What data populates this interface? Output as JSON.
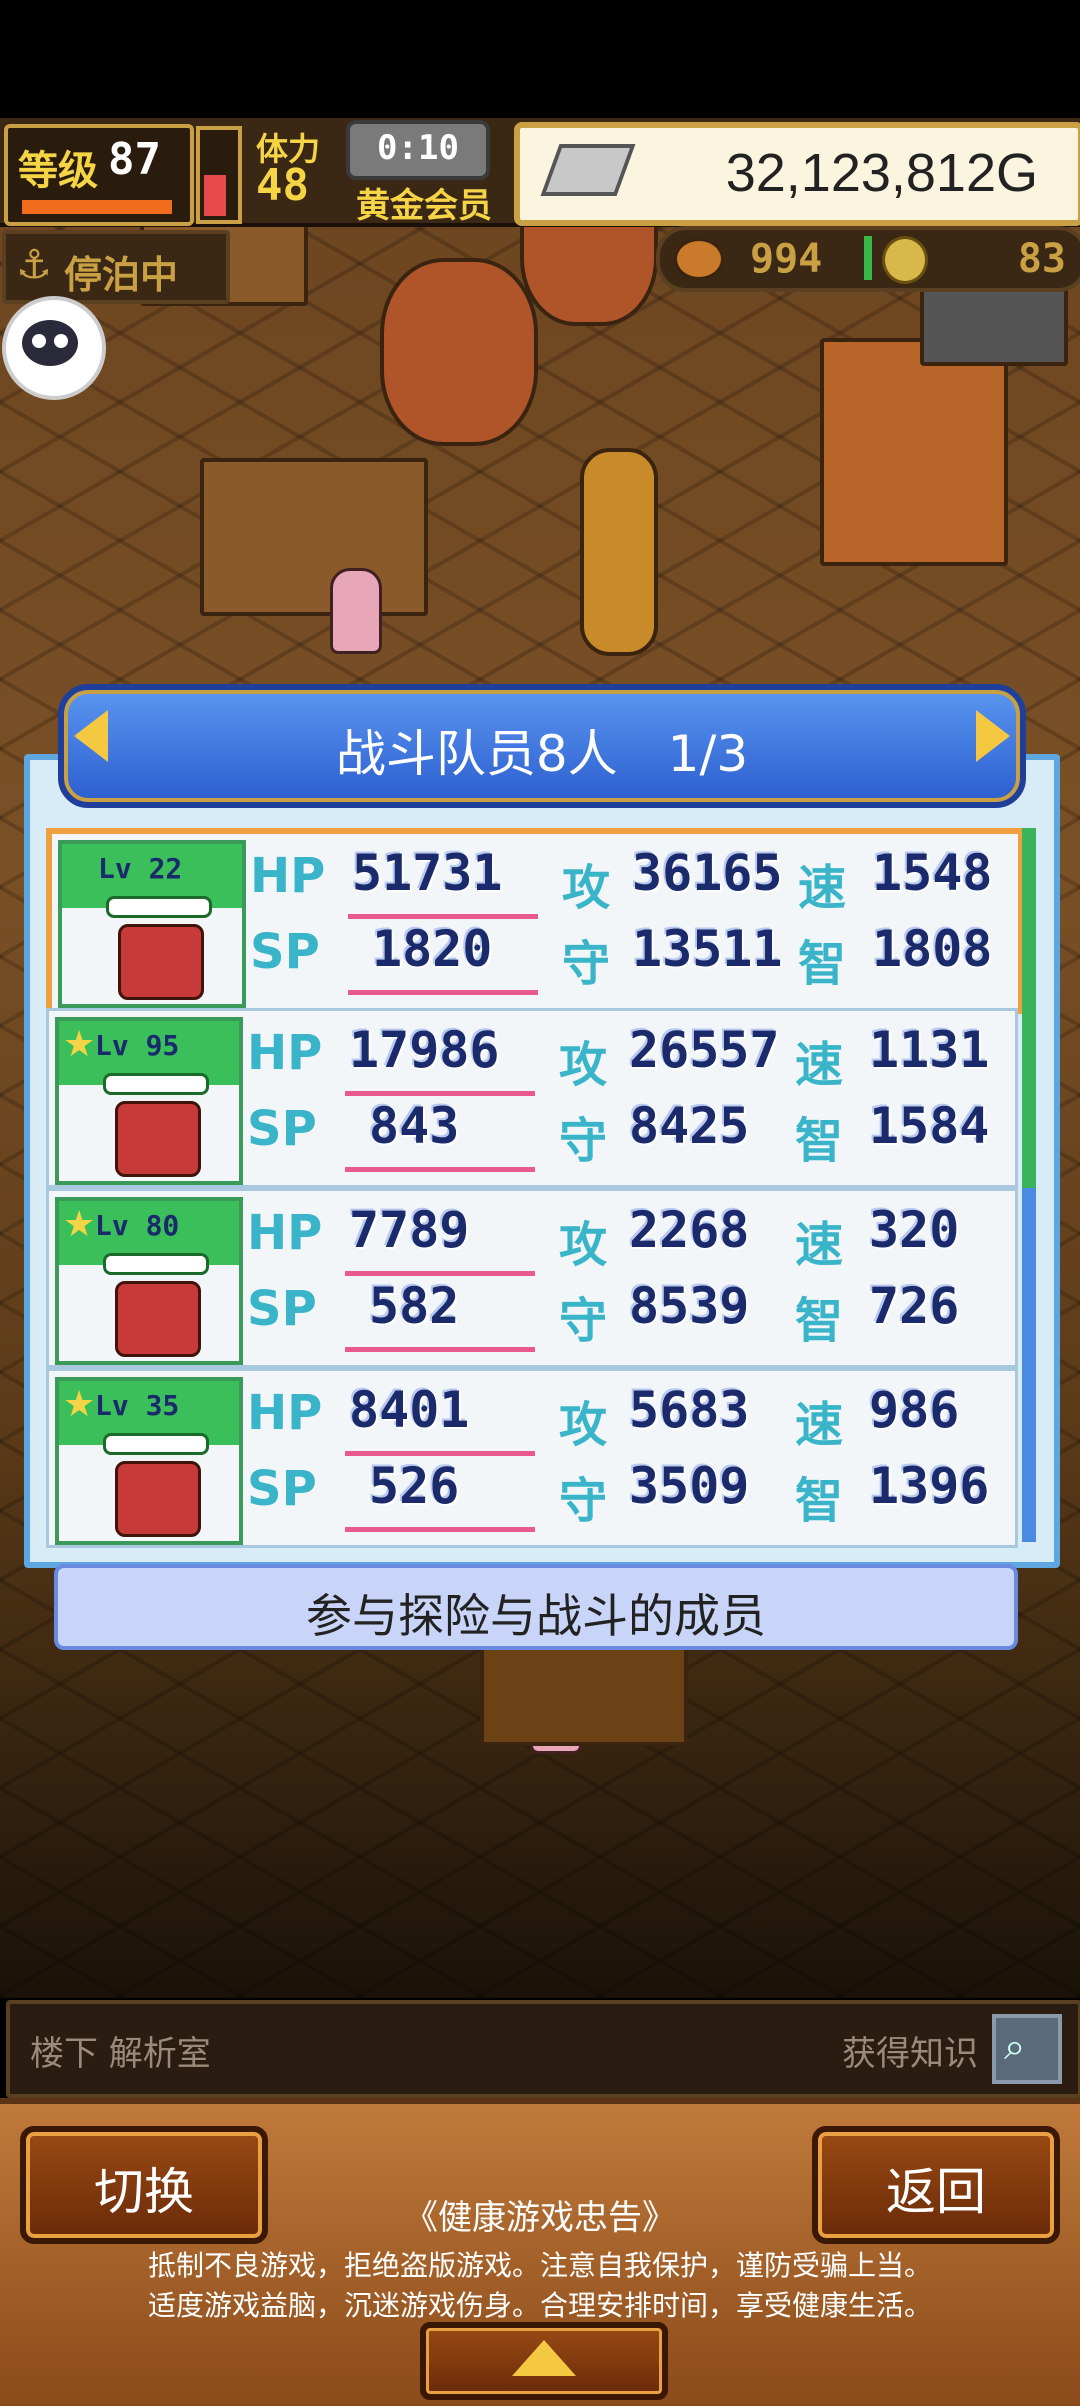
{
  "status": {
    "level_label": "等级",
    "level": "87",
    "stamina_label": "体力",
    "stamina": "48",
    "stamina_fill": 0.5,
    "timer": "0:10",
    "membership": "黄金会员",
    "money": "32,123,812G",
    "docked": "停泊中",
    "food": "994",
    "coins": "83"
  },
  "panel": {
    "title": "战斗队员8人　1/3",
    "caption": "参与探险与战斗的成员",
    "labels": {
      "hp": "HP",
      "sp": "SP",
      "atk": "攻",
      "def": "守",
      "spd": "速",
      "int": "智"
    },
    "members": [
      {
        "lv": "Lv 22",
        "star": "",
        "hp": "51731",
        "sp": "1820",
        "atk": "36165",
        "def": "13511",
        "spd": "1548",
        "int": "1808"
      },
      {
        "lv": "Lv 95",
        "star": "★",
        "hp": "17986",
        "sp": "843",
        "atk": "26557",
        "def": "8425",
        "spd": "1131",
        "int": "1584"
      },
      {
        "lv": "Lv 80",
        "star": "★",
        "hp": "7789",
        "sp": "582",
        "atk": "2268",
        "def": "8539",
        "spd": "320",
        "int": "726"
      },
      {
        "lv": "Lv 35",
        "star": "★",
        "hp": "8401",
        "sp": "526",
        "atk": "5683",
        "def": "3509",
        "spd": "986",
        "int": "1396"
      }
    ]
  },
  "info_bar": {
    "location": "楼下 解析室",
    "knowledge": "获得知识"
  },
  "footer": {
    "switch_label": "切换",
    "back_label": "返回",
    "notice_title": "《健康游戏忠告》",
    "notice_line1": "抵制不良游戏，拒绝盗版游戏。注意自我保护，谨防受骗上当。",
    "notice_line2": "适度游戏益脑，沉迷游戏伤身。合理安排时间，享受健康生活。"
  },
  "colors": {
    "accent_gold": "#c9a043",
    "panel_blue": "#2c5ecf",
    "stat_cyan": "#3ab4c8",
    "stat_navy": "#1a2a6a",
    "selected_orange": "#f0a040"
  },
  "icons": [
    "anchor-icon",
    "food-icon",
    "coin-icon",
    "money-icon",
    "magnifier-icon",
    "prev-arrow-icon",
    "next-arrow-icon",
    "star-icon",
    "expand-arrow-icon"
  ]
}
